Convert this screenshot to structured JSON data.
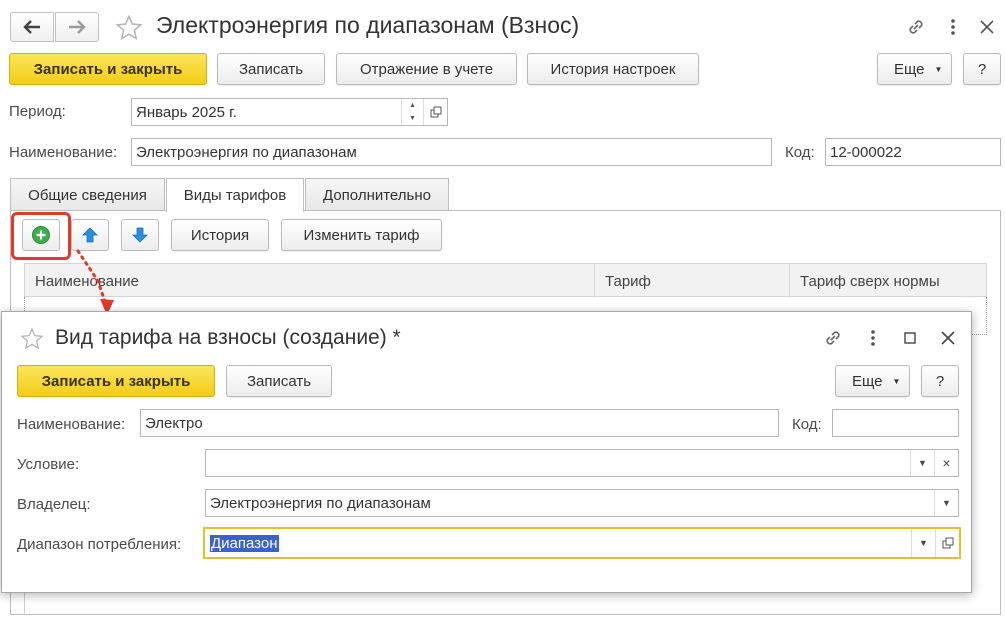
{
  "main": {
    "title": "Электроэнергия по диапазонам (Взнос)",
    "toolbar": {
      "save_close": "Записать и закрыть",
      "save": "Записать",
      "posting": "Отражение в учете",
      "history_settings": "История настроек",
      "more": "Еще",
      "help": "?"
    },
    "period": {
      "label": "Период:",
      "value": "Январь 2025 г."
    },
    "name": {
      "label": "Наименование:",
      "value": "Электроэнергия по диапазонам"
    },
    "code": {
      "label": "Код:",
      "value": "12-000022"
    },
    "tabs": [
      {
        "label": "Общие сведения"
      },
      {
        "label": "Виды тарифов"
      },
      {
        "label": "Дополнительно"
      }
    ],
    "tab_toolbar": {
      "history": "История",
      "change_tariff": "Изменить тариф"
    },
    "table": {
      "columns": [
        "Наименование",
        "Тариф",
        "Тариф сверх нормы"
      ]
    }
  },
  "dialog": {
    "title": "Вид тарифа на взносы (создание) *",
    "toolbar": {
      "save_close": "Записать и закрыть",
      "save": "Записать",
      "more": "Еще",
      "help": "?"
    },
    "name": {
      "label": "Наименование:",
      "value": "Электро"
    },
    "code": {
      "label": "Код:",
      "value": ""
    },
    "condition": {
      "label": "Условие:",
      "value": ""
    },
    "owner": {
      "label": "Владелец:",
      "value": "Электроэнергия по диапазонам"
    },
    "range": {
      "label": "Диапазон потребления:",
      "value": "Диапазон"
    }
  },
  "colors": {
    "accent_yellow": "#f5d327",
    "highlight_red": "#e03a2c",
    "selection_blue": "#3a62c8",
    "focus_border": "#e8bf2a",
    "add_green": "#3cae4a",
    "arrow_blue": "#2b8fdc"
  }
}
